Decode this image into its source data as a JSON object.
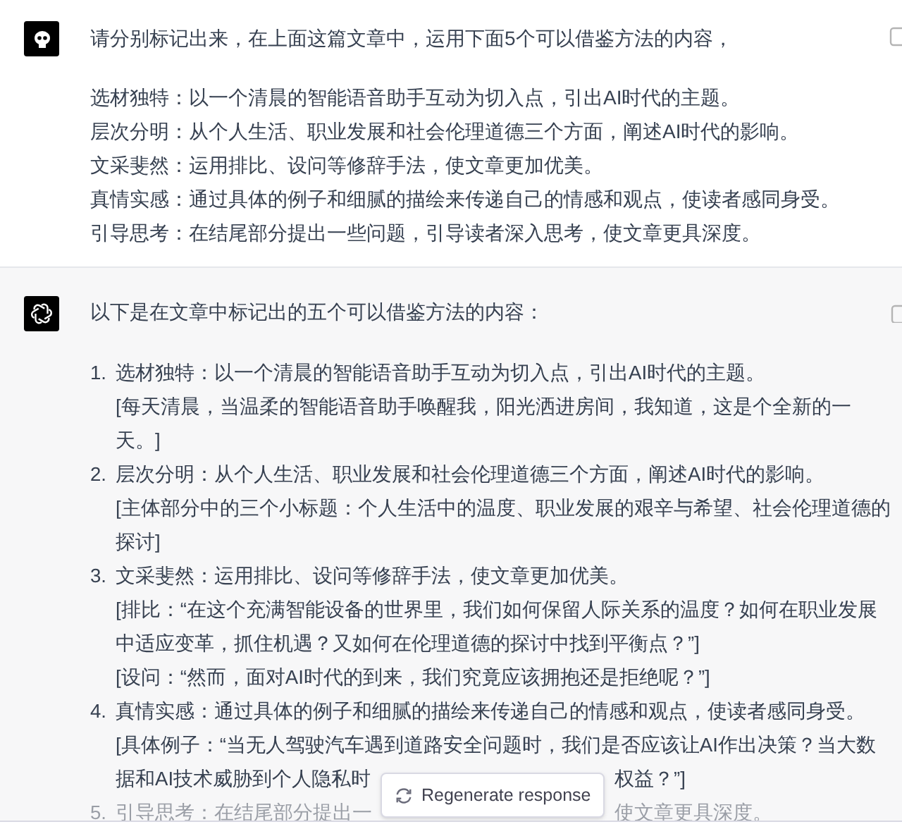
{
  "user_message": {
    "prompt": "请分别标记出来，在上面这篇文章中，运用下面5个可以借鉴方法的内容，",
    "points": [
      "选材独特：以一个清晨的智能语音助手互动为切入点，引出AI时代的主题。",
      "层次分明：从个人生活、职业发展和社会伦理道德三个方面，阐述AI时代的影响。",
      "文采斐然：运用排比、设问等修辞手法，使文章更加优美。",
      "真情实感：通过具体的例子和细腻的描绘来传递自己的情感和观点，使读者感同身受。",
      "引导思考：在结尾部分提出一些问题，引导读者深入思考，使文章更具深度。"
    ]
  },
  "assistant_message": {
    "intro": "以下是在文章中标记出的五个可以借鉴方法的内容：",
    "items": [
      {
        "number": "1.",
        "text": "选材独特：以一个清晨的智能语音助手互动为切入点，引出AI时代的主题。",
        "faded": false,
        "quotes": [
          {
            "lines": [
              "[每天清晨，当温柔的智能语音助手唤醒我，阳光洒进房间，我知道，这是个全新的一",
              "天。]"
            ]
          }
        ]
      },
      {
        "number": "2.",
        "text": "层次分明：从个人生活、职业发展和社会伦理道德三个方面，阐述AI时代的影响。",
        "faded": false,
        "quotes": [
          {
            "lines": [
              "[主体部分中的三个小标题：个人生活中的温度、职业发展的艰辛与希望、社会伦理道德的",
              "探讨]"
            ]
          }
        ]
      },
      {
        "number": "3.",
        "text": "文采斐然：运用排比、设问等修辞手法，使文章更加优美。",
        "faded": false,
        "quotes": [
          {
            "lines": [
              "[排比：“在这个充满智能设备的世界里，我们如何保留人际关系的温度？如何在职业发展",
              "中适应变革，抓住机遇？又如何在伦理道德的探讨中找到平衡点？”]"
            ]
          },
          {
            "lines": [
              "[设问：“然而，面对AI时代的到来，我们究竟应该拥抱还是拒绝呢？”]"
            ]
          }
        ]
      },
      {
        "number": "4.",
        "text": "真情实感：通过具体的例子和细腻的描绘来传递自己的情感和观点，使读者感同身受。",
        "faded": false,
        "quotes": [
          {
            "lines": [
              "[具体例子：“当无人驾驶汽车遇到道路安全问题时，我们是否应该让AI作出决策？当大数",
              "据和AI技术威胁到个人隐私时"
            ],
            "tail": "权益？”]"
          }
        ]
      },
      {
        "number": "5.",
        "text": "引导思考：在结尾部分提出一",
        "tail": "使文章更具深度。",
        "faded": true
      }
    ]
  },
  "regenerate_button": {
    "label": "Regenerate response"
  }
}
